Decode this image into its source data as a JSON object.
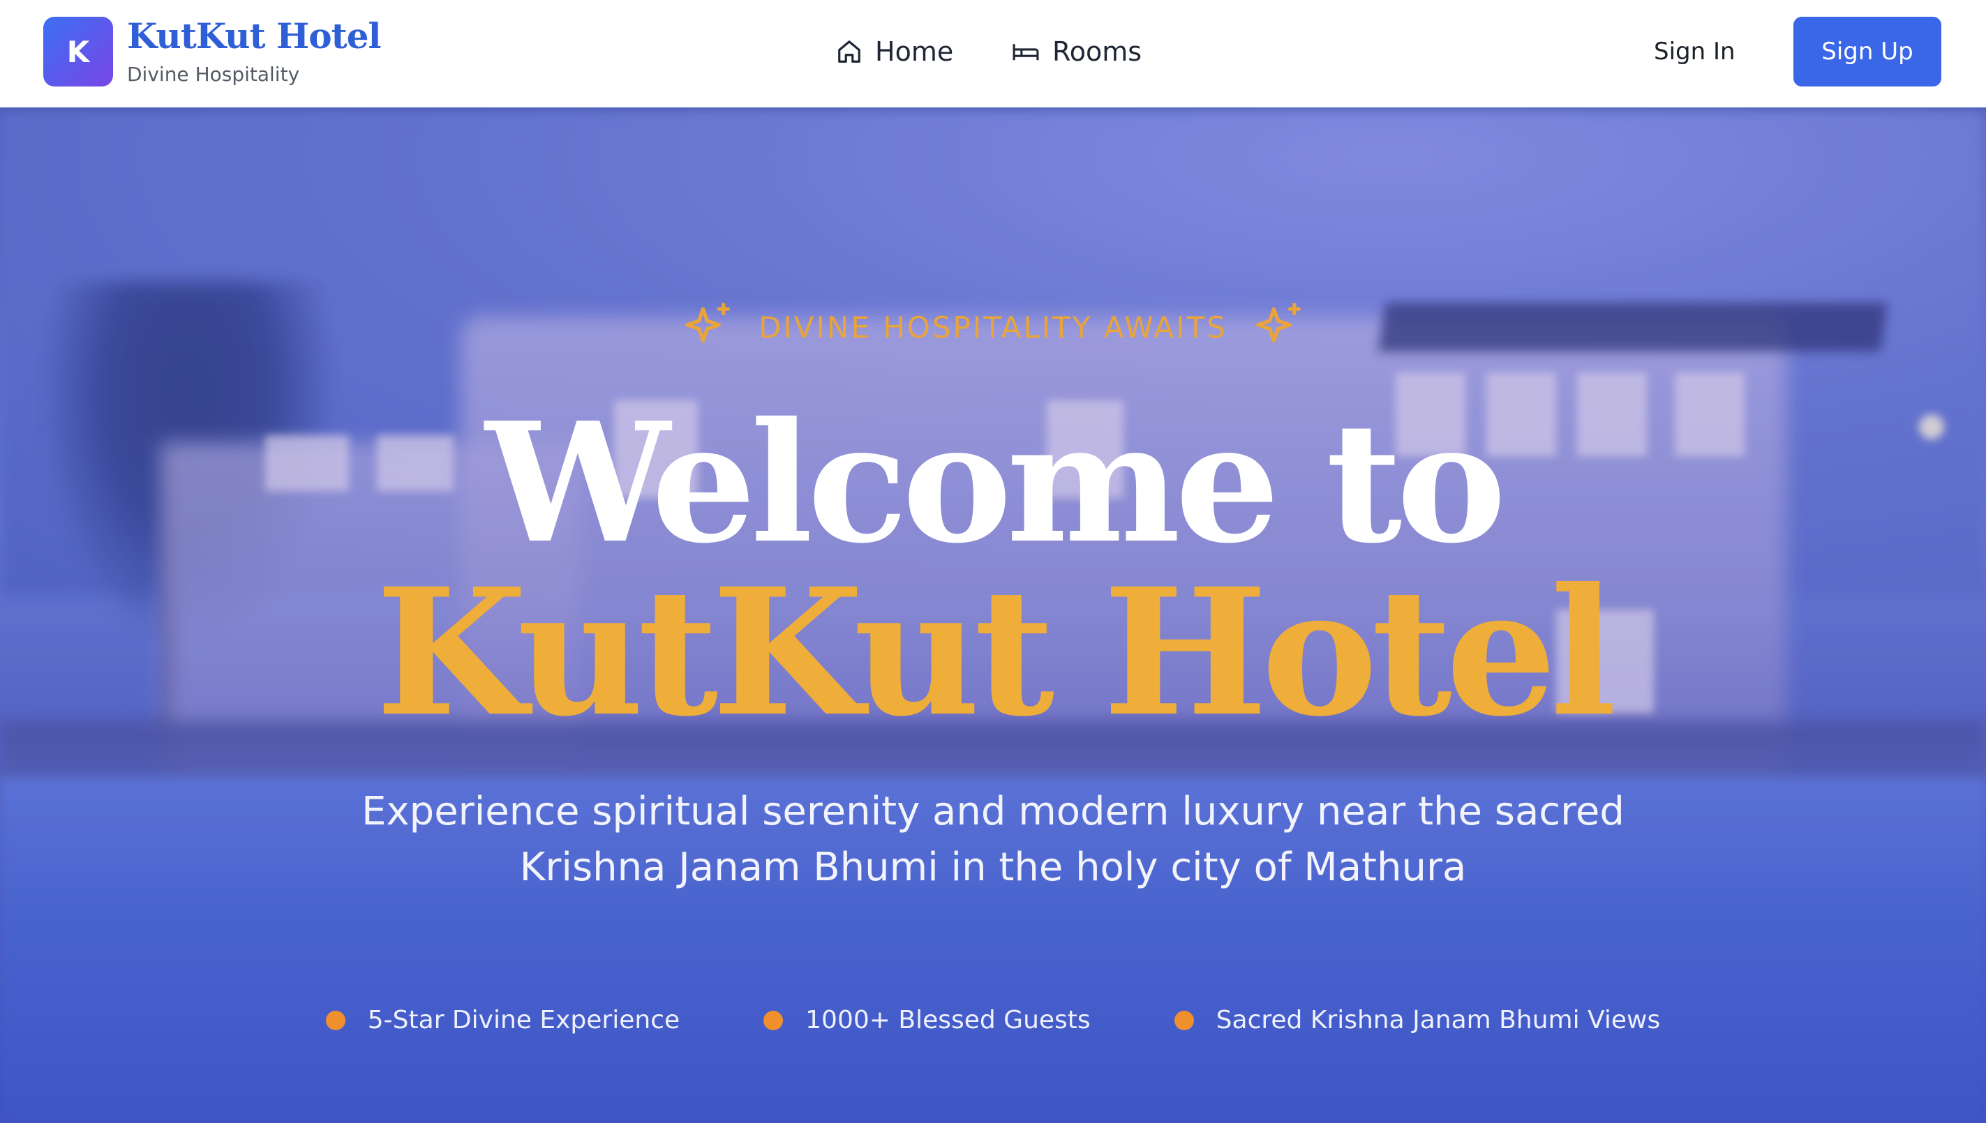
{
  "header": {
    "logo_letter": "K",
    "brand_name": "KutKut Hotel",
    "brand_tagline": "Divine Hospitality",
    "nav": [
      {
        "label": "Home",
        "icon": "home-icon"
      },
      {
        "label": "Rooms",
        "icon": "bed-icon"
      }
    ],
    "sign_in_label": "Sign In",
    "sign_up_label": "Sign Up"
  },
  "hero": {
    "tagline": "DIVINE HOSPITALITY AWAITS",
    "title_line1": "Welcome to",
    "title_line2": "KutKut Hotel",
    "subtitle": "Experience spiritual serenity and modern luxury near the sacred Krishna Janam Bhumi in the holy city of Mathura",
    "features": [
      "5-Star Divine Experience",
      "1000+ Blessed Guests",
      "Sacred Krishna Janam Bhumi Views"
    ],
    "background": "blurred hotel exterior with pool at dusk"
  },
  "colors": {
    "brand_blue": "#3a67e8",
    "accent_gold": "#efae3a",
    "feature_dot": "#f0902d"
  }
}
